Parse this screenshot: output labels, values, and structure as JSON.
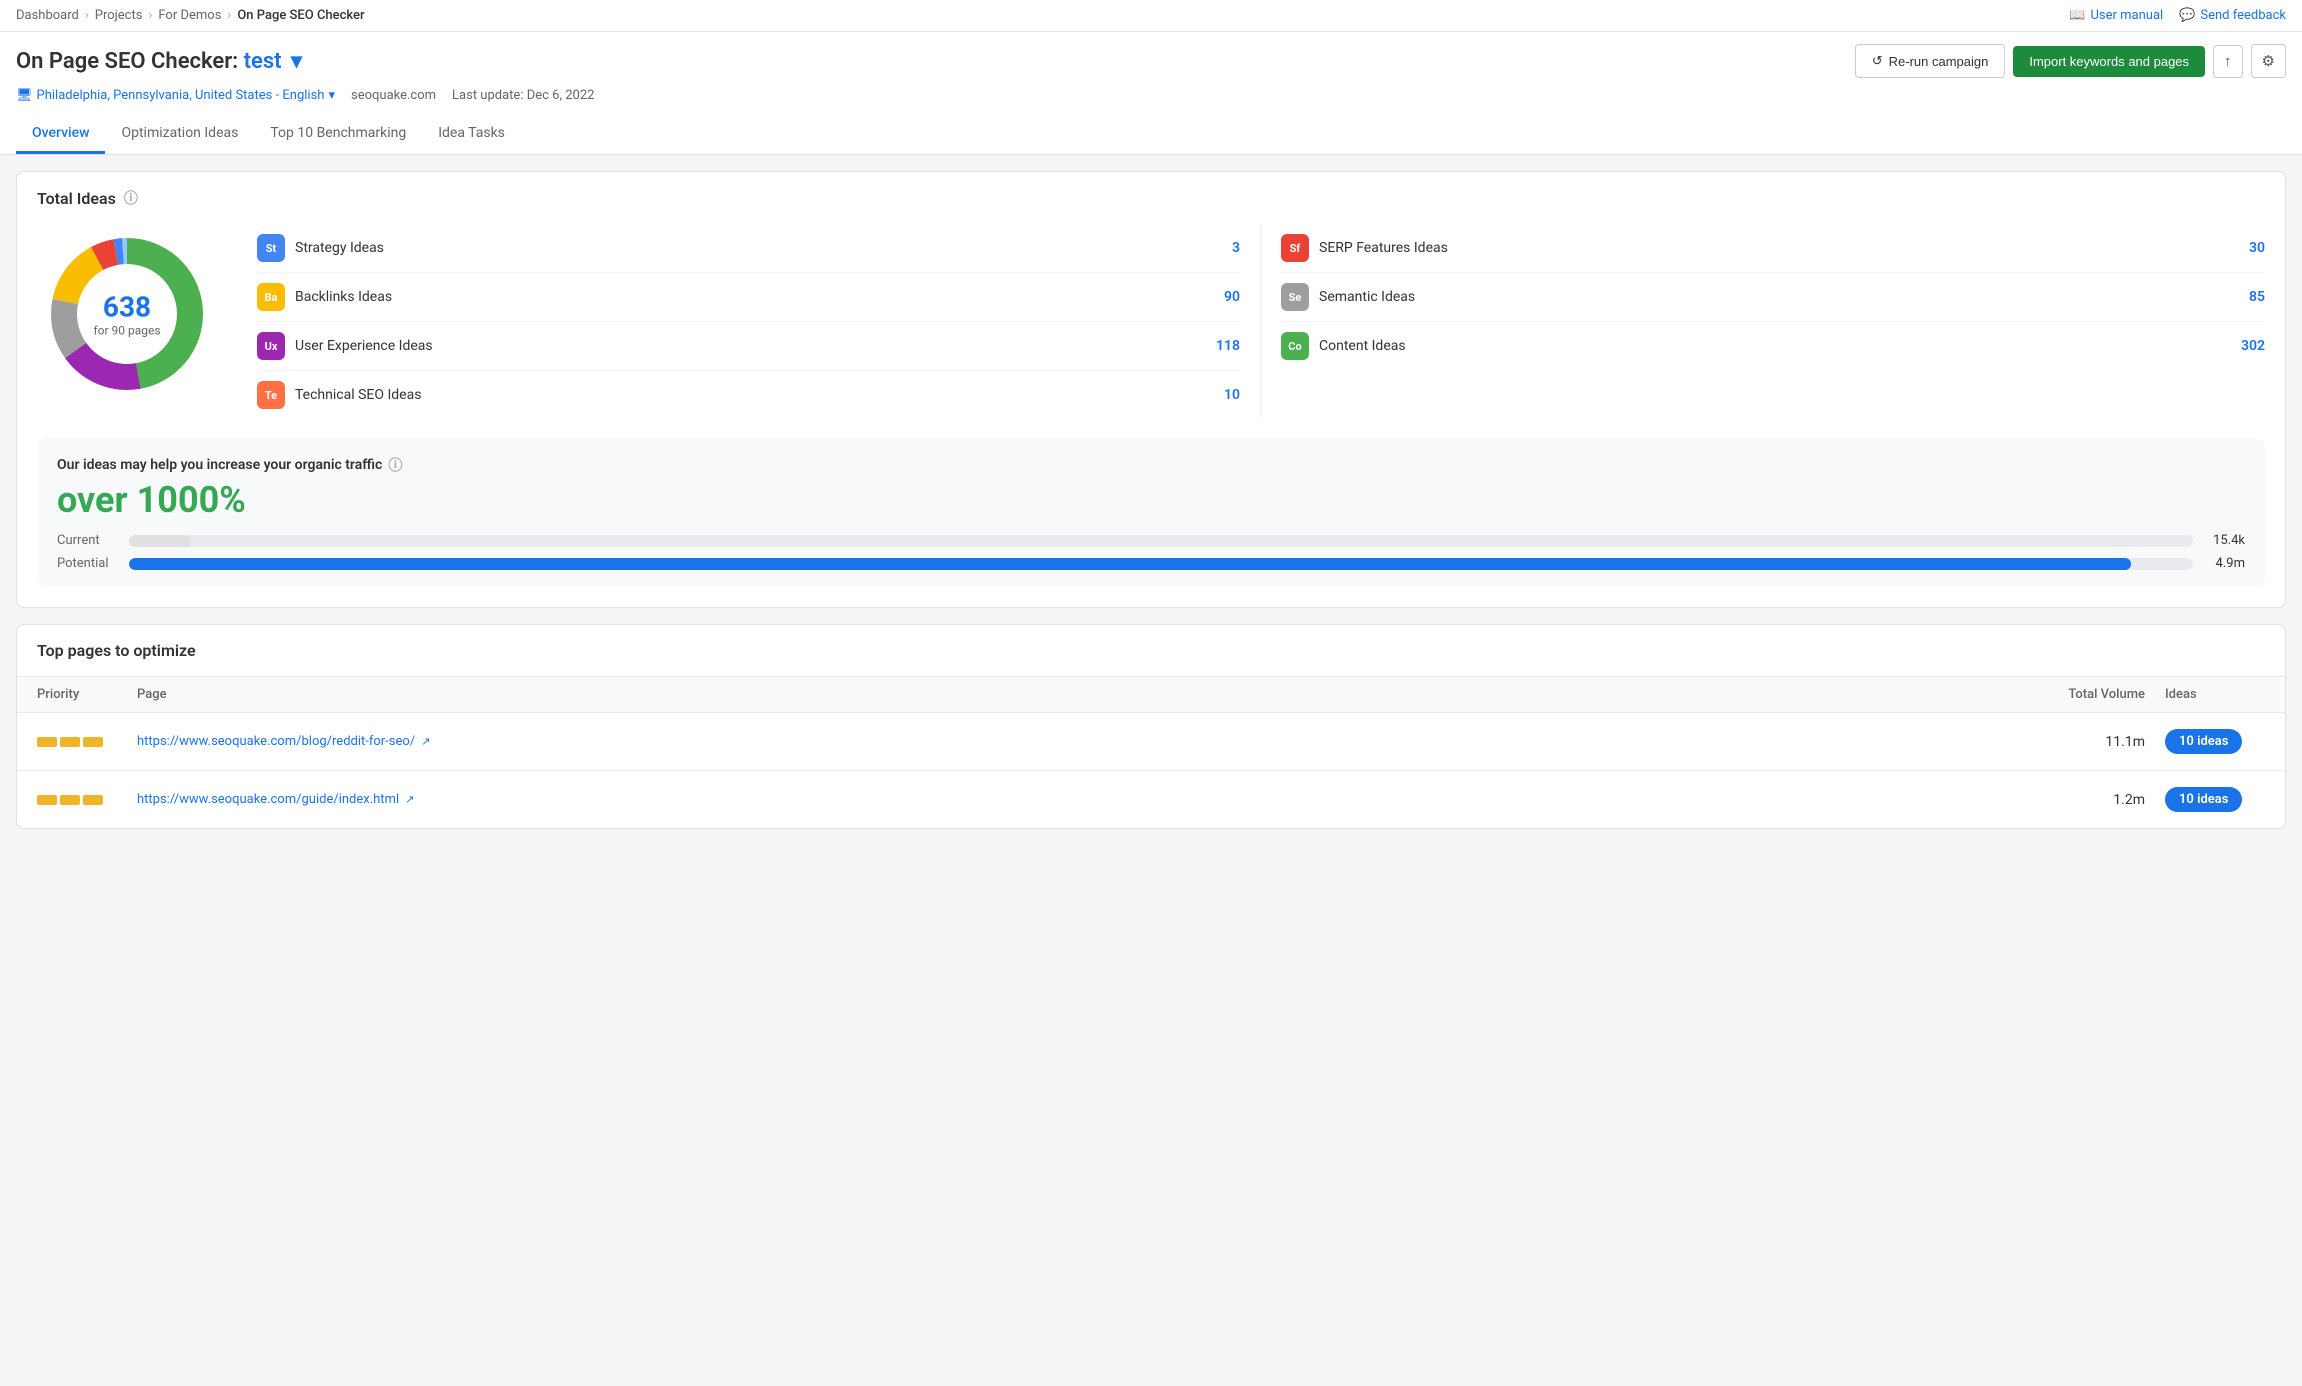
{
  "topBar": {
    "breadcrumbs": [
      "Dashboard",
      "Projects",
      "For Demos",
      "On Page SEO Checker"
    ],
    "userManual": "User manual",
    "sendFeedback": "Send feedback"
  },
  "header": {
    "titlePrefix": "On Page SEO Checker:",
    "titleHighlight": "test",
    "location": "Philadelphia, Pennsylvania, United States - English",
    "domain": "seoquake.com",
    "lastUpdate": "Last update: Dec 6, 2022",
    "rerunBtn": "Re-run campaign",
    "importBtn": "Import keywords and pages"
  },
  "tabs": [
    {
      "label": "Overview",
      "active": true
    },
    {
      "label": "Optimization Ideas",
      "active": false
    },
    {
      "label": "Top 10 Benchmarking",
      "active": false
    },
    {
      "label": "Idea Tasks",
      "active": false
    }
  ],
  "totalIdeas": {
    "title": "Total Ideas",
    "donut": {
      "number": "638",
      "label": "for 90 pages"
    },
    "leftIdeas": [
      {
        "abbr": "St",
        "color": "#4285f4",
        "name": "Strategy Ideas",
        "count": "3"
      },
      {
        "abbr": "Ba",
        "color": "#fbbc04",
        "name": "Backlinks Ideas",
        "count": "90"
      },
      {
        "abbr": "Ux",
        "color": "#9c27b0",
        "name": "User Experience Ideas",
        "count": "118"
      },
      {
        "abbr": "Te",
        "color": "#ff7043",
        "name": "Technical SEO Ideas",
        "count": "10"
      }
    ],
    "rightIdeas": [
      {
        "abbr": "Sf",
        "color": "#ea4335",
        "name": "SERP Features Ideas",
        "count": "30"
      },
      {
        "abbr": "Se",
        "color": "#9e9e9e",
        "name": "Semantic Ideas",
        "count": "85"
      },
      {
        "abbr": "Co",
        "color": "#4caf50",
        "name": "Content Ideas",
        "count": "302"
      }
    ]
  },
  "traffic": {
    "title": "Our ideas may help you increase your organic traffic",
    "percent": "over 1000%",
    "current": {
      "label": "Current",
      "value": "15.4k",
      "fill": 3
    },
    "potential": {
      "label": "Potential",
      "value": "4.9m",
      "fill": 97
    }
  },
  "topPages": {
    "title": "Top pages to optimize",
    "columns": [
      "Priority",
      "Page",
      "Total Volume",
      "Ideas"
    ],
    "rows": [
      {
        "priority": 3,
        "url": "https://www.seoquake.com/blog/reddit-for-seo/",
        "volume": "11.1m",
        "ideas": "10 ideas"
      },
      {
        "priority": 3,
        "url": "https://www.seoquake.com/guide/index.html",
        "volume": "1.2m",
        "ideas": "10 ideas"
      }
    ]
  },
  "donutSegments": [
    {
      "color": "#4caf50",
      "percent": 47
    },
    {
      "color": "#9c27b0",
      "percent": 18
    },
    {
      "color": "#9e9e9e",
      "percent": 13
    },
    {
      "color": "#fbbc04",
      "percent": 14
    },
    {
      "color": "#ea4335",
      "percent": 5
    },
    {
      "color": "#4285f4",
      "percent": 1
    },
    {
      "color": "#90caf9",
      "percent": 1
    },
    {
      "color": "#ff7043",
      "percent": 1
    }
  ]
}
